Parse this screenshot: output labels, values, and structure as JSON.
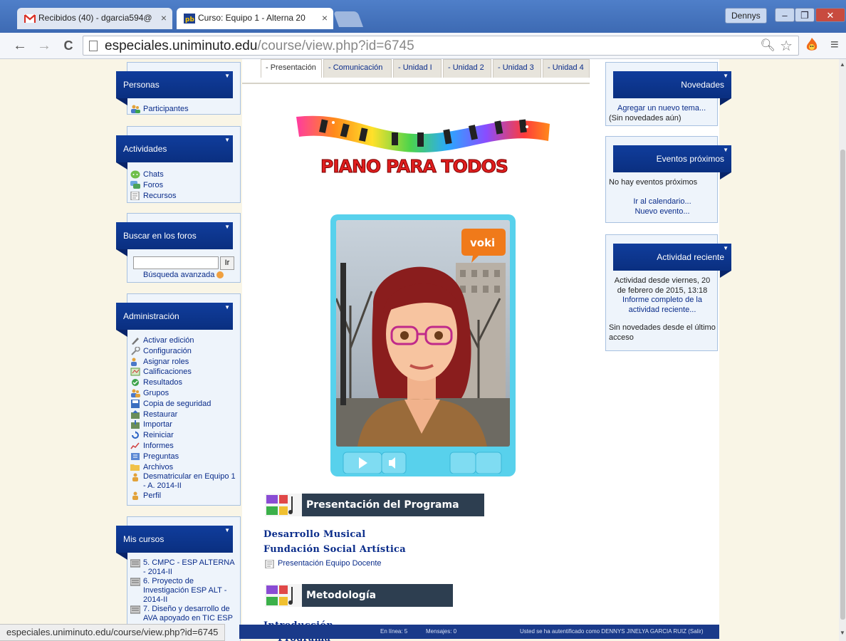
{
  "browser": {
    "tabs": [
      {
        "title": "Recibidos (40) - dgarcia594@",
        "close": "×"
      },
      {
        "title": "Curso: Equipo 1 - Alterna 20",
        "close": "×"
      }
    ],
    "user": "Dennys",
    "window_buttons": {
      "minimize": "–",
      "restore": "❐",
      "close": "✕"
    },
    "nav": {
      "back": "←",
      "forward": "→",
      "reload": "C"
    },
    "url_host": "especiales.uniminuto.edu",
    "url_path": "/course/view.php?id=6745",
    "status_url": "especiales.uniminuto.edu/course/view.php?id=6745"
  },
  "left_blocks": {
    "personas": {
      "title": "Personas",
      "items": [
        "Participantes"
      ]
    },
    "actividades": {
      "title": "Actividades",
      "items": [
        "Chats",
        "Foros",
        "Recursos"
      ]
    },
    "buscar": {
      "title": "Buscar en los foros",
      "button": "Ir",
      "advanced": "Búsqueda avanzada"
    },
    "administracion": {
      "title": "Administración",
      "items": [
        "Activar edición",
        "Configuración",
        "Asignar roles",
        "Calificaciones",
        "Resultados",
        "Grupos",
        "Copia de seguridad",
        "Restaurar",
        "Importar",
        "Reiniciar",
        "Informes",
        "Preguntas",
        "Archivos",
        "Desmatricular en Equipo 1 - A. 2014-II",
        "Perfil"
      ]
    },
    "mis_cursos": {
      "title": "Mis cursos",
      "items": [
        "5. CMPC - ESP ALTERNA - 2014-II",
        "6. Proyecto de Investigación ESP ALT - 2014-II",
        "7. Diseño y desarrollo de AVA apoyado en TIC ESP"
      ]
    }
  },
  "center": {
    "tabs": [
      "- Presentación",
      "- Comunicación",
      "- Unidad I",
      "- Unidad 2",
      "- Unidad 3",
      "- Unidad 4"
    ],
    "logo_text": "PIANO PARA TODOS",
    "voki_badge": "voki",
    "section1": {
      "title": "Presentación del Programa",
      "lines": [
        "Desarrollo Musical",
        "Fundación Social Artística"
      ],
      "resource": "Presentación Equipo Docente"
    },
    "section2": {
      "title": "Metodología",
      "line": "Introducción",
      "line2": "Programa"
    }
  },
  "right_blocks": {
    "novedades": {
      "title": "Novedades",
      "link": "Agregar un nuevo tema...",
      "note": "(Sin novedades aún)"
    },
    "eventos": {
      "title": "Eventos próximos",
      "note": "No hay eventos próximos",
      "links": [
        "Ir al calendario...",
        "Nuevo evento..."
      ]
    },
    "actividad": {
      "title": "Actividad reciente",
      "since": "Actividad desde viernes, 20 de febrero de 2015, 13:18",
      "report": "Informe completo de la actividad reciente...",
      "none": "Sin novedades desde el último acceso"
    }
  },
  "footer": {
    "online": "En línea: 5",
    "messages": "Mensajes: 0",
    "user": "Usted se ha autentificado como DENNYS JINELYA GARCIA RUIZ (Salir)"
  },
  "colors": {
    "block_header": "#103d9c",
    "link": "#0a2c8a",
    "page_bg": "#f9f5e6",
    "banner": "#2d3e50",
    "voki_frame": "#58d1ec"
  }
}
